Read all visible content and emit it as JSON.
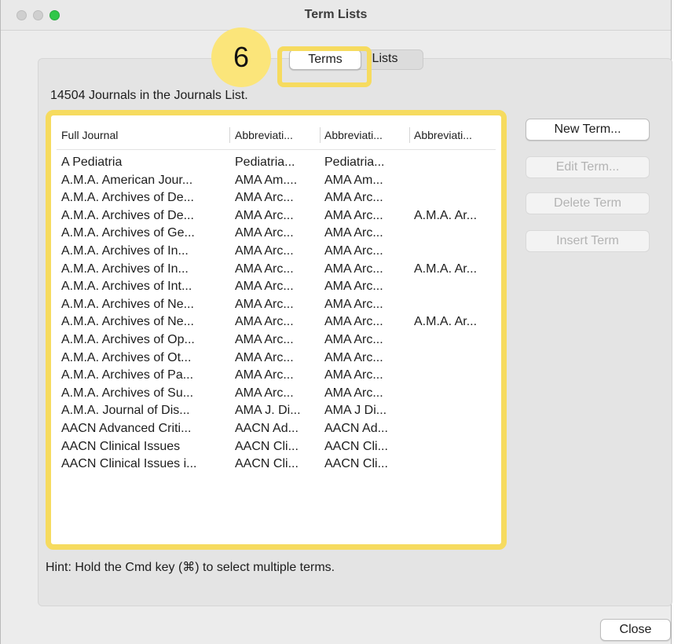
{
  "window": {
    "title": "Term Lists"
  },
  "step_badge": "6",
  "tabs": {
    "terms": "Terms",
    "lists": "Lists"
  },
  "count_label": "14504 Journals in the Journals List.",
  "table": {
    "columns": [
      "Full Journal",
      "Abbreviati...",
      "Abbreviati...",
      "Abbreviati..."
    ],
    "rows": [
      [
        "A Pediatria",
        "Pediatria...",
        "Pediatria...",
        ""
      ],
      [
        "A.M.A. American Jour...",
        "AMA Am....",
        "AMA Am...",
        ""
      ],
      [
        "A.M.A. Archives of De...",
        "AMA Arc...",
        "AMA Arc...",
        ""
      ],
      [
        "A.M.A. Archives of De...",
        "AMA Arc...",
        "AMA Arc...",
        "A.M.A. Ar..."
      ],
      [
        "A.M.A. Archives of Ge...",
        "AMA Arc...",
        "AMA Arc...",
        ""
      ],
      [
        "A.M.A. Archives of In...",
        "AMA Arc...",
        "AMA Arc...",
        ""
      ],
      [
        "A.M.A. Archives of In...",
        "AMA Arc...",
        "AMA Arc...",
        "A.M.A. Ar..."
      ],
      [
        "A.M.A. Archives of Int...",
        "AMA Arc...",
        "AMA Arc...",
        ""
      ],
      [
        "A.M.A. Archives of Ne...",
        "AMA Arc...",
        "AMA Arc...",
        ""
      ],
      [
        "A.M.A. Archives of Ne...",
        "AMA Arc...",
        "AMA Arc...",
        "A.M.A. Ar..."
      ],
      [
        "A.M.A. Archives of Op...",
        "AMA Arc...",
        "AMA Arc...",
        ""
      ],
      [
        "A.M.A. Archives of Ot...",
        "AMA Arc...",
        "AMA Arc...",
        ""
      ],
      [
        "A.M.A. Archives of Pa...",
        "AMA Arc...",
        "AMA Arc...",
        ""
      ],
      [
        "A.M.A. Archives of Su...",
        "AMA Arc...",
        "AMA Arc...",
        ""
      ],
      [
        "A.M.A. Journal of Dis...",
        "AMA J. Di...",
        "AMA J Di...",
        ""
      ],
      [
        "AACN Advanced Criti...",
        "AACN Ad...",
        "AACN Ad...",
        ""
      ],
      [
        "AACN Clinical Issues",
        "AACN Cli...",
        "AACN Cli...",
        ""
      ],
      [
        "AACN Clinical Issues i...",
        "AACN Cli...",
        "AACN Cli...",
        ""
      ]
    ]
  },
  "buttons": {
    "new_term": "New Term...",
    "edit_term": "Edit Term...",
    "delete_term": "Delete Term",
    "insert_term": "Insert Term",
    "close": "Close"
  },
  "hint": "Hint: Hold the Cmd key (⌘) to select multiple terms.",
  "colors": {
    "highlight": "#f6db5f",
    "badge": "#fbe57a",
    "zoom": "#30c748"
  }
}
